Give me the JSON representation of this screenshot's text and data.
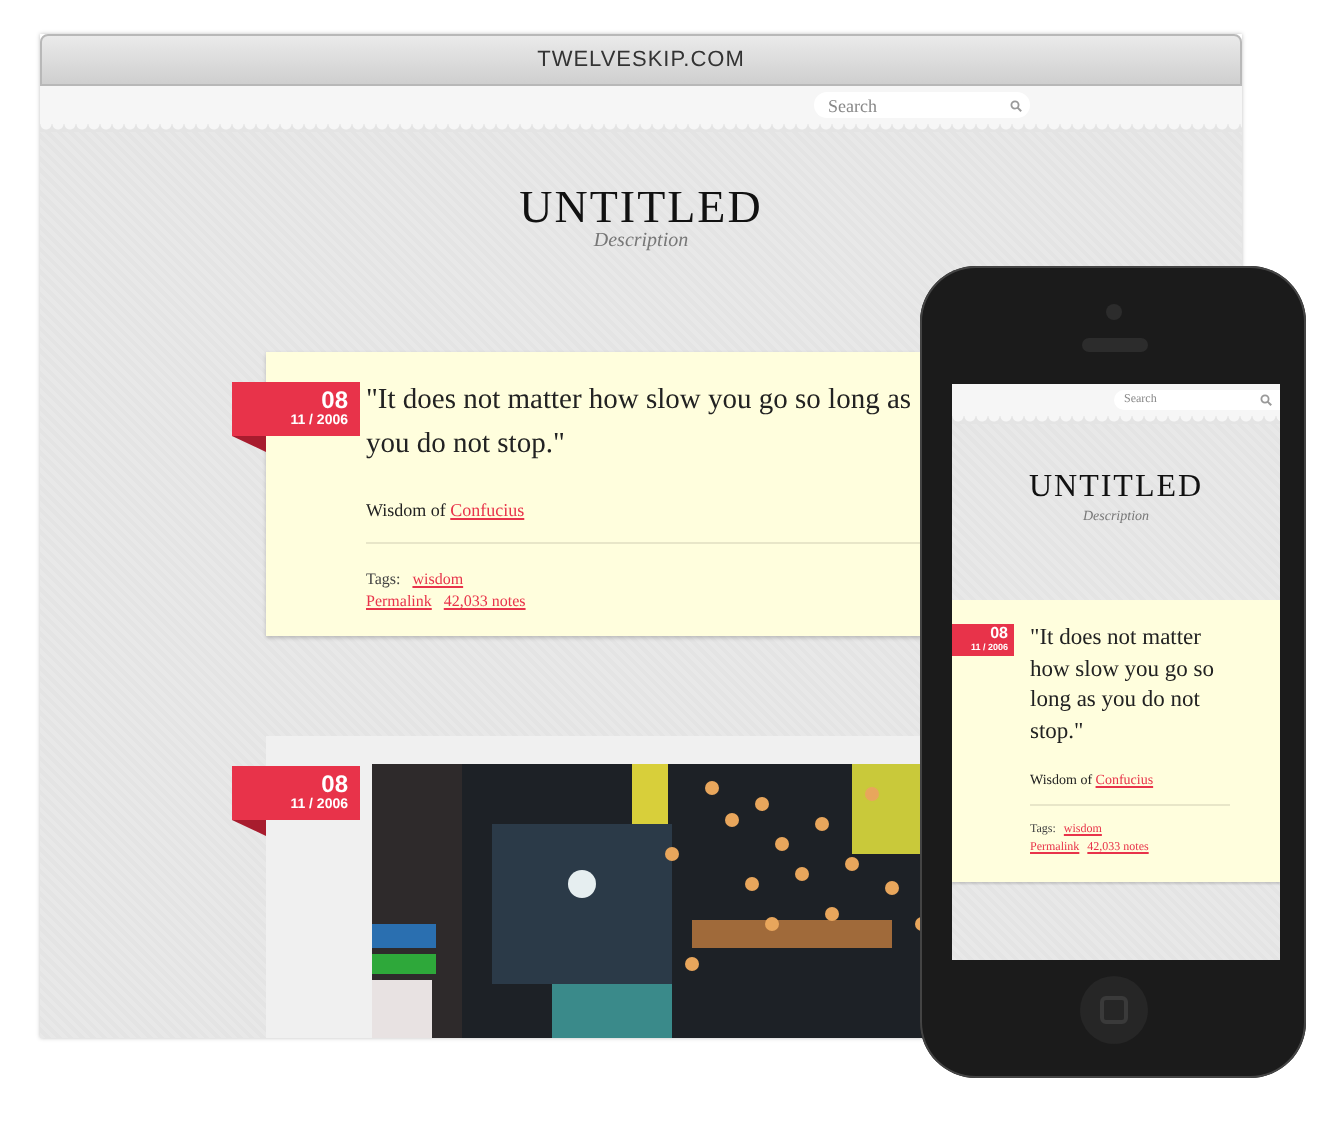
{
  "browser": {
    "address": "TWELVESKIP.COM",
    "search": {
      "placeholder": "Search"
    },
    "blog": {
      "title": "UNTITLED",
      "description": "Description"
    },
    "posts": [
      {
        "kind": "quote",
        "day": "08",
        "date": "11 / 2006",
        "quote": "\"It does not matter how slow you go so long as you do not stop.\"",
        "source_label": "Wisdom of",
        "source": "Confucius",
        "tags_label": "Tags:",
        "tags": [
          "wisdom"
        ],
        "permalink": "Permalink",
        "notes": "42,033 notes"
      },
      {
        "day": "08",
        "date": "11 / 2006"
      }
    ]
  },
  "phone": {
    "search": {
      "placeholder": "Search"
    },
    "blog": {
      "title": "UNTITLED",
      "description": "Description"
    },
    "posts": [
      {
        "kind": "quote",
        "day": "08",
        "date": "11 / 2006",
        "quote": "\"It does not matter how slow you go so long as you do not stop.\"",
        "source_label": "Wisdom of",
        "source": "Confucius",
        "tags_label": "Tags:",
        "tags": [
          "wisdom"
        ],
        "permalink": "Permalink",
        "notes": "42,033 notes"
      }
    ]
  }
}
